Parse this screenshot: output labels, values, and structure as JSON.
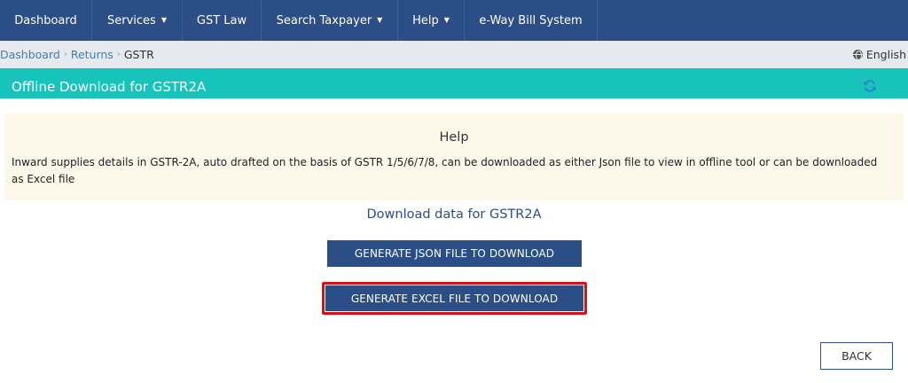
{
  "nav": {
    "items": [
      {
        "label": "Dashboard",
        "caret": false
      },
      {
        "label": "Services",
        "caret": true
      },
      {
        "label": "GST Law",
        "caret": false
      },
      {
        "label": "Search Taxpayer",
        "caret": true
      },
      {
        "label": "Help",
        "caret": true
      },
      {
        "label": "e-Way Bill System",
        "caret": false
      }
    ]
  },
  "breadcrumb": {
    "items": [
      "Dashboard",
      "Returns"
    ],
    "current": "GSTR",
    "language": "English"
  },
  "header": {
    "title": "Offline Download for GSTR2A"
  },
  "help": {
    "title": "Help",
    "text": "Inward supplies details in GSTR-2A, auto drafted on the basis of GSTR 1/5/6/7/8, can be downloaded as either Json file to view in offline tool or can be downloaded as Excel file"
  },
  "download": {
    "heading": "Download data for GSTR2A",
    "json_button": "GENERATE JSON FILE TO DOWNLOAD",
    "excel_button": "GENERATE EXCEL FILE TO DOWNLOAD",
    "back_button": "BACK"
  },
  "colors": {
    "nav_bg": "#2c4e86",
    "header_bg": "#17c4bb",
    "help_bg": "#fdf8ea",
    "highlight": "#e01010",
    "link": "#3b7fc4"
  }
}
